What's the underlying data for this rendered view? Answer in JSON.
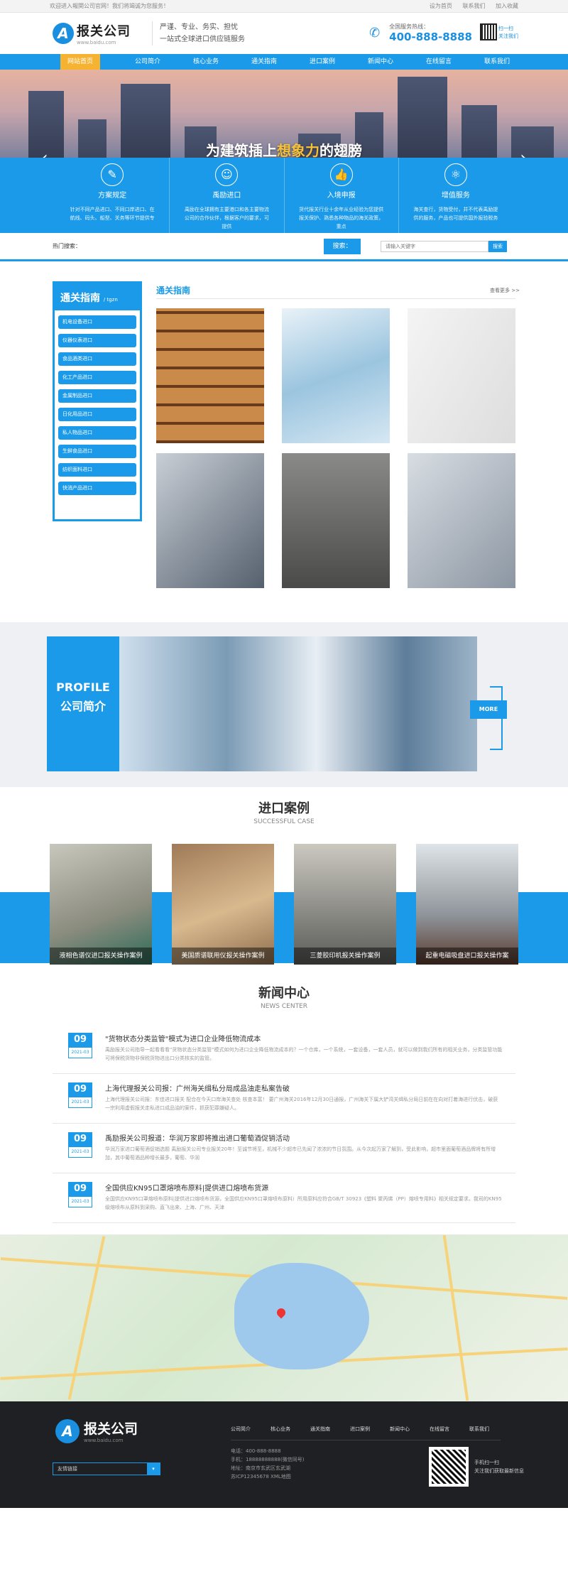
{
  "topbar": {
    "welcome": "欢迎进入報関公司官网！我们将竭诚为您服务！",
    "links": [
      "设为首页",
      "联系我们",
      "加入收藏"
    ]
  },
  "header": {
    "logo_letter": "A",
    "company_name": "报关公司",
    "url": "www.baidu.com",
    "slogan_line1": "严谨、专业、务实、担忧",
    "slogan_line2": "一站式全球进口供应链服务",
    "hotline_label": "全国服务热线：",
    "hotline_number": "400-888-8888",
    "qr_text_1": "扫一扫",
    "qr_text_2": "关注我们"
  },
  "nav": {
    "items": [
      "网站首页",
      "公司简介",
      "核心业务",
      "通关指南",
      "进口案例",
      "新闻中心",
      "在线留言",
      "联系我们"
    ]
  },
  "banner": {
    "title_part1": "为建筑插上",
    "title_highlight": "想象力",
    "title_part2": "的翅膀",
    "prev": "‹",
    "next": "›"
  },
  "services": [
    {
      "icon": "✎",
      "title": "方案规定",
      "desc": "针对不同产品进口、不同口岸进口、在航线、码头、船型、关务等环节提供专"
    },
    {
      "icon": "☺",
      "title": "禹励进口",
      "desc": "禹励在全球拥有主要港口和各主要物流公司的合作伙伴，根据客户的要求，可提供"
    },
    {
      "icon": "👍",
      "title": "入境申报",
      "desc": "货代报关行业十余年从业经验为您提供报关保护、熟悉各种物品的海关政策，重点"
    },
    {
      "icon": "⚛",
      "title": "增值服务",
      "desc": "海关查行，货物受付，并不代表禹励提供的服务，产品也可提供国外报验税务"
    }
  ],
  "search": {
    "hot_label": "热门搜索：",
    "label": "搜索：",
    "placeholder": "请输入关键字",
    "button": "搜索"
  },
  "guide": {
    "side_title": "通关指南",
    "side_sub": "/ tgzn",
    "side_items": [
      "机电设备进口",
      "仪器仪表进口",
      "食品酒类进口",
      "化工产品进口",
      "金属制品进口",
      "日化用品进口",
      "私人物品进口",
      "生鲜食品进口",
      "纺织面料进口",
      "快消产品进口"
    ],
    "title": "通关指南",
    "more": "查看更多 >>"
  },
  "profile": {
    "en": "PROFILE",
    "cn": "公司简介",
    "more": "MORE"
  },
  "cases": {
    "title": "进口案例",
    "subtitle": "SUCCESSFUL CASE",
    "items": [
      "液相色谱仪进口报关操作案例",
      "美国质谱联用仪报关操作案例",
      "三菱胶印机报关操作案例",
      "起重电磁吸盘进口报关操作案"
    ]
  },
  "news": {
    "title": "新闻中心",
    "subtitle": "NEWS CENTER",
    "items": [
      {
        "day": "09",
        "ym": "2021-03",
        "title": "\"货物状态分类监管\"模式为进口企业降低物流成本",
        "desc": "禹励报关公司指导一起看看看\"货物状态分类监管\"模式如何为进口企业降低物流成本的？一个仓库，一个系统，一套设备，一套人员，就可以做到我们所有的相关业务，分类监管功能可将保税货物非保税货物进出口分类核实的监管。"
      },
      {
        "day": "09",
        "ym": "2021-03",
        "title": "上海代理报关公司报：广州海关缉私分局成品油走私案告破",
        "desc": "上海代理报关公司报：东佳进口报关 配合在今天口岸海关查处 核查本富！ 要广州海关2016年12月30日通报，广州海关下属大铲湾关缉私分局日前在在向对打着海进行伏击，破获一宗利用虚假报关走私进口成品油的案件，抓获犯罪嫌疑人。"
      },
      {
        "day": "09",
        "ym": "2021-03",
        "title": "禹励报关公司报道：华润万家即将推出进口葡萄酒促销活动",
        "desc": "华润万家进口葡萄酒促销选题 禹励报关公司专业报关20年！至诚节将至，机械不少超市已先闻了浓浓的节日氛围。从今次起万家了解到，受此影响，超市里面葡萄酒品牌将有所增加，其中葡萄酒品种增长最多，葡萄、华润"
      },
      {
        "day": "09",
        "ym": "2021-03",
        "title": "全国供应KN95口罩熔喷布原料|提供进口熔喷布货源",
        "desc": "全国供应KN95口罩熔喷布原料|提供进口熔喷布货源，全国供应KN95口罩熔喷布原料）所用原料应符合GB/T 30923《塑料 聚丙烯（PP）熔喷专用料》相关规定要求。我司的KN95级熔喷布从原料到采购、直飞出来、上海、广州、天津"
      }
    ]
  },
  "footer": {
    "name": "报关公司",
    "url": "www.baidu.com",
    "links_label": "友情链接",
    "nav": [
      "公司简介",
      "核心业务",
      "通关指南",
      "进口案例",
      "新闻中心",
      "在线留言",
      "联系我们"
    ],
    "info": [
      "电话：400-888-8888",
      "手机：18888888888(微信同号)",
      "地址：南京市玄武区玄武湖",
      "苏ICP12345678 XML地图"
    ],
    "qr_text_1": "手机扫一扫",
    "qr_text_2": "关注我们获取最新信息"
  },
  "colors": {
    "accent": "#1a9ae8",
    "highlight": "#f6b331"
  }
}
